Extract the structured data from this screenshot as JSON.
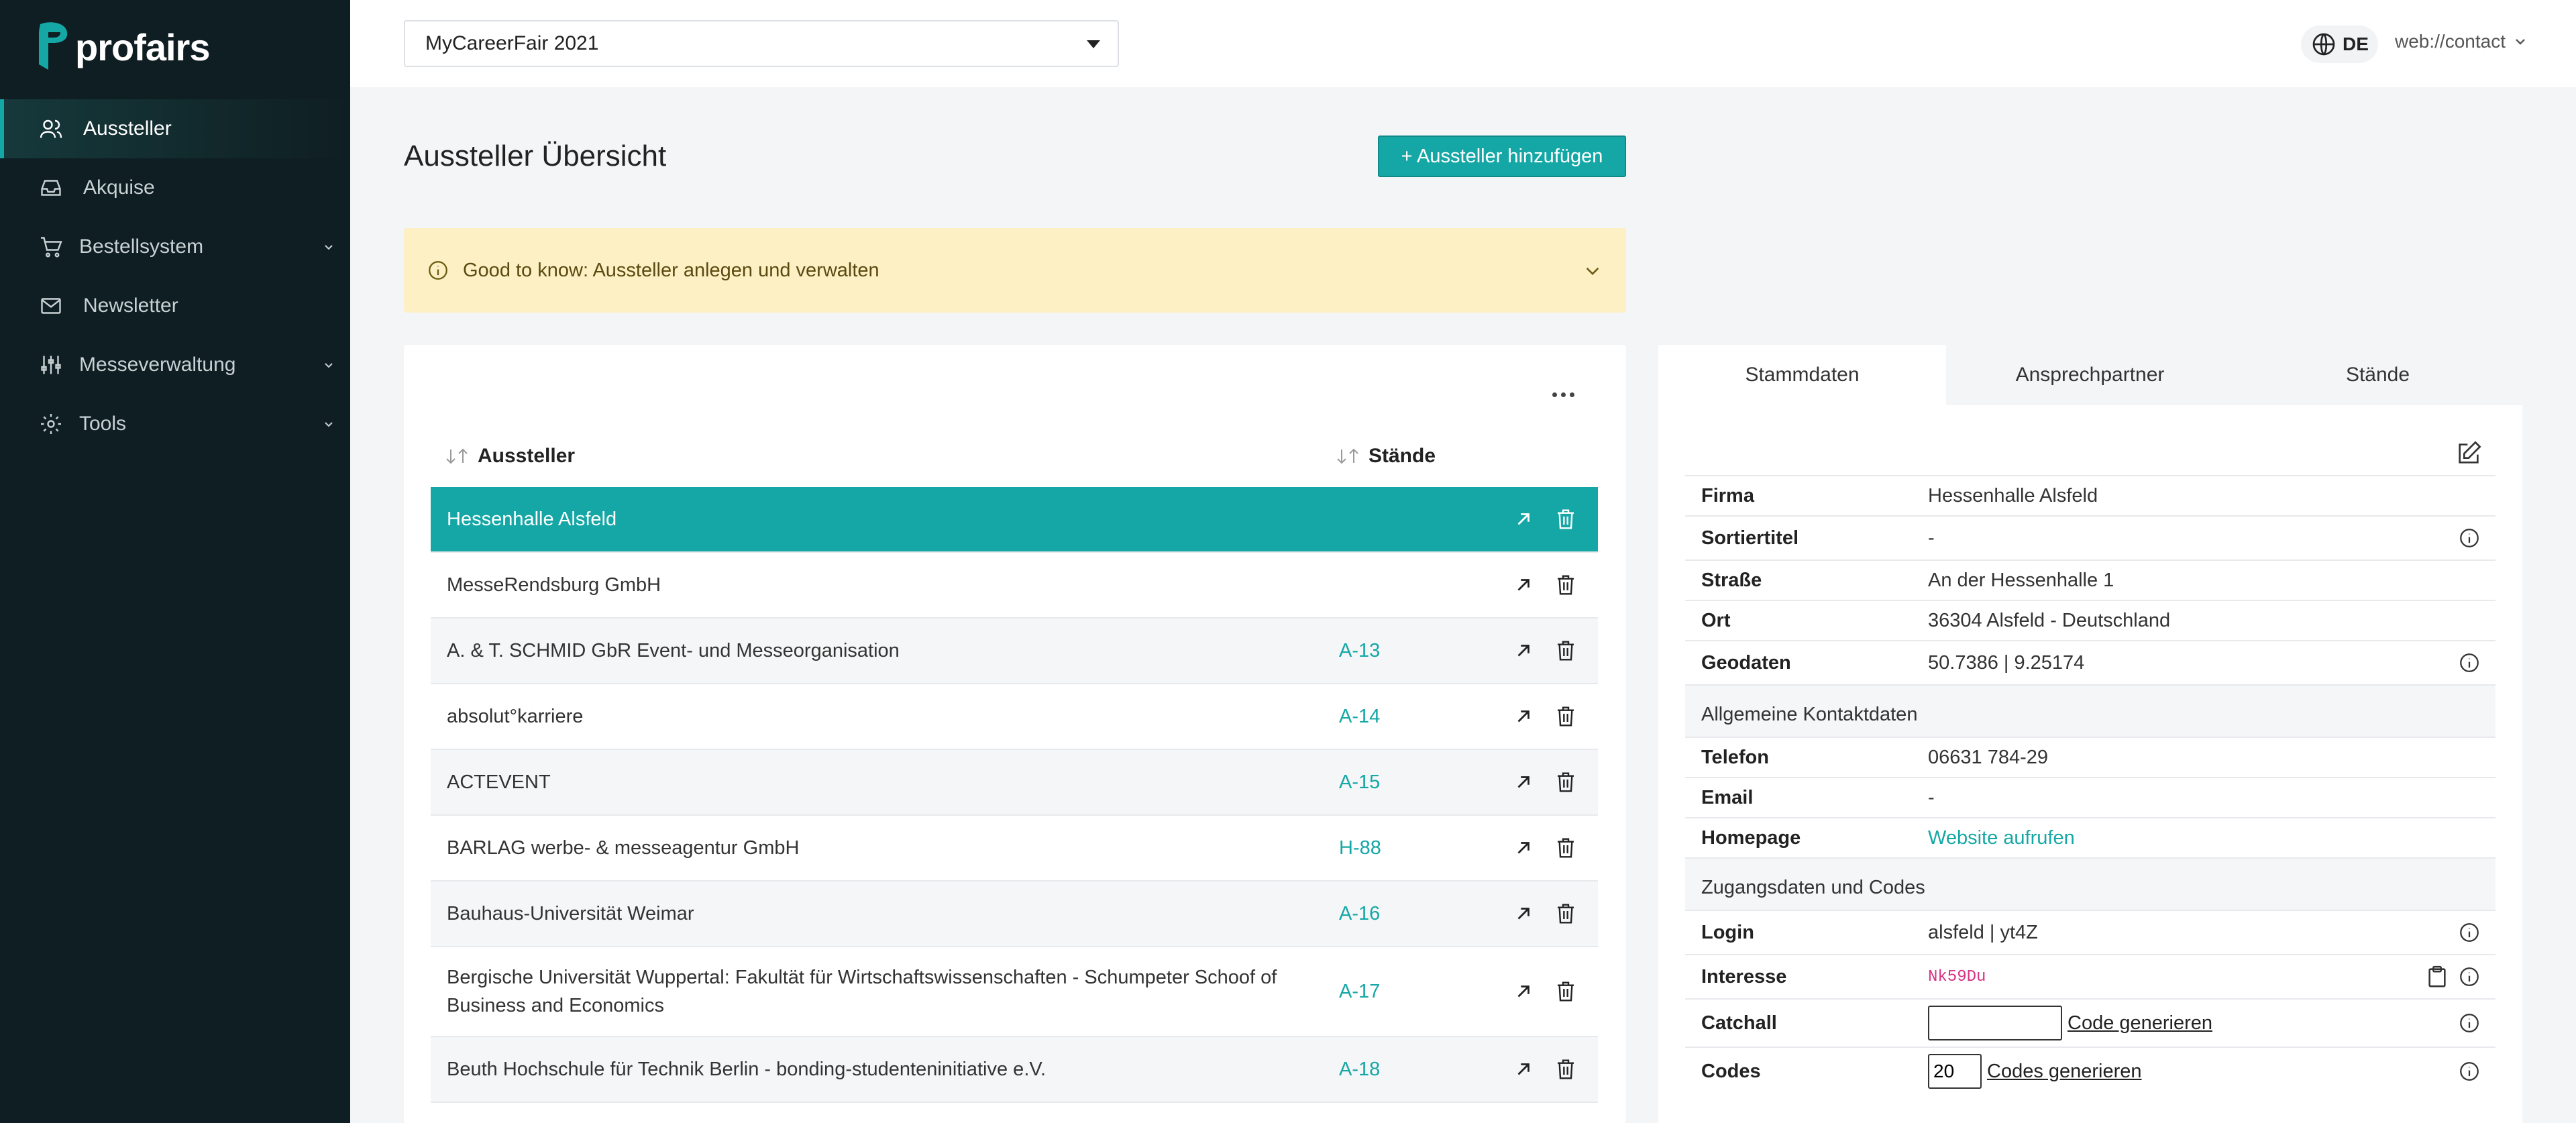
{
  "brand": {
    "name": "profairs",
    "accent": "#14a7a6",
    "sidebar_bg": "#0f1e22"
  },
  "sidebar": {
    "items": [
      {
        "label": "Aussteller",
        "icon": "users-icon",
        "active": true,
        "expandable": false
      },
      {
        "label": "Akquise",
        "icon": "inbox-icon",
        "active": false,
        "expandable": false
      },
      {
        "label": "Bestellsystem",
        "icon": "cart-icon",
        "active": false,
        "expandable": true
      },
      {
        "label": "Newsletter",
        "icon": "mail-icon",
        "active": false,
        "expandable": false
      },
      {
        "label": "Messeverwaltung",
        "icon": "sliders-icon",
        "active": false,
        "expandable": true
      },
      {
        "label": "Tools",
        "icon": "gear-icon",
        "active": false,
        "expandable": true
      }
    ]
  },
  "topbar": {
    "event_select": "MyCareerFair 2021",
    "language": "DE",
    "account": "web://contact"
  },
  "main": {
    "title": "Aussteller Übersicht",
    "add_button": "+ Aussteller hinzufügen",
    "info_banner": "Good to know: Aussteller anlegen und verwalten",
    "table": {
      "columns": {
        "name": "Aussteller",
        "stand": "Stände"
      },
      "rows": [
        {
          "name": "Hessenhalle Alsfeld",
          "stand": "",
          "selected": true
        },
        {
          "name": "MesseRendsburg GmbH",
          "stand": "",
          "selected": false
        },
        {
          "name": "A. & T. SCHMID GbR Event- und Messeorganisation",
          "stand": "A-13",
          "selected": false
        },
        {
          "name": "absolut°karriere",
          "stand": "A-14",
          "selected": false
        },
        {
          "name": "ACTEVENT",
          "stand": "A-15",
          "selected": false
        },
        {
          "name": "BARLAG werbe- & messeagentur GmbH",
          "stand": "H-88",
          "selected": false
        },
        {
          "name": "Bauhaus-Universität Weimar",
          "stand": "A-16",
          "selected": false
        },
        {
          "name": "Bergische Universität Wuppertal: Fakultät für Wirtschaftswissenschaften - Schumpeter Schoof of Business and Economics",
          "stand": "A-17",
          "selected": false
        },
        {
          "name": "Beuth Hochschule für Technik Berlin - bonding-studenteninitiative e.V.",
          "stand": "A-18",
          "selected": false
        }
      ]
    }
  },
  "detail": {
    "tabs": [
      "Stammdaten",
      "Ansprechpartner",
      "Stände"
    ],
    "active_tab": "Stammdaten",
    "firma_label": "Firma",
    "firma": "Hessenhalle Alsfeld",
    "sortiertitel_label": "Sortiertitel",
    "sortiertitel": "-",
    "strasse_label": "Straße",
    "strasse": "An der Hessenhalle 1",
    "ort_label": "Ort",
    "ort": "36304 Alsfeld - Deutschland",
    "geodaten_label": "Geodaten",
    "geodaten": "50.7386 | 9.25174",
    "section_contact": "Allgemeine Kontaktdaten",
    "telefon_label": "Telefon",
    "telefon": "06631 784-29",
    "email_label": "Email",
    "email": "-",
    "homepage_label": "Homepage",
    "homepage": "Website aufrufen",
    "section_access": "Zugangsdaten und Codes",
    "login_label": "Login",
    "login": "alsfeld | yt4Z",
    "interesse_label": "Interesse",
    "interesse": "Nk59Du",
    "catchall_label": "Catchall",
    "catchall_value": "",
    "catchall_link": "Code generieren",
    "codes_label": "Codes",
    "codes_value": "20",
    "codes_link": "Codes generieren"
  }
}
